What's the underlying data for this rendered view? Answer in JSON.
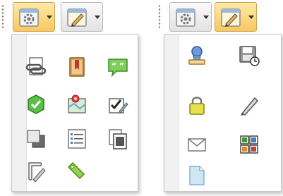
{
  "toolbar_left": {
    "buttons": [
      {
        "icon": "gear-icon",
        "state": "open"
      },
      {
        "icon": "edit-document-icon",
        "state": "normal"
      }
    ]
  },
  "menu_left": {
    "items": [
      {
        "icon": "link-document-icon"
      },
      {
        "icon": "bookmark-icon"
      },
      {
        "icon": "comment-icon"
      },
      {
        "icon": "approved-icon"
      },
      {
        "icon": "map-location-icon"
      },
      {
        "icon": "checklist-edit-icon"
      },
      {
        "icon": "layers-icon"
      },
      {
        "icon": "list-icon"
      },
      {
        "icon": "copy-pages-icon"
      },
      {
        "icon": "script-edit-icon"
      },
      {
        "icon": "tag-icon"
      }
    ]
  },
  "toolbar_right": {
    "buttons": [
      {
        "icon": "gear-icon",
        "state": "normal"
      },
      {
        "icon": "edit-document-icon",
        "state": "open"
      }
    ]
  },
  "menu_right": {
    "items": [
      {
        "icon": "user-stamp-icon"
      },
      {
        "icon": "save-schedule-icon"
      },
      {
        "icon": "lock-icon"
      },
      {
        "icon": "pen-icon"
      },
      {
        "icon": "mail-icon"
      },
      {
        "icon": "grid-view-icon"
      },
      {
        "icon": "blank-page-icon"
      }
    ]
  },
  "colors": {
    "active_button_top": "#ffe9a8",
    "active_button_bottom": "#f7c860",
    "menu_background": "#ffffff",
    "menu_gutter": "#f1f1f1"
  }
}
